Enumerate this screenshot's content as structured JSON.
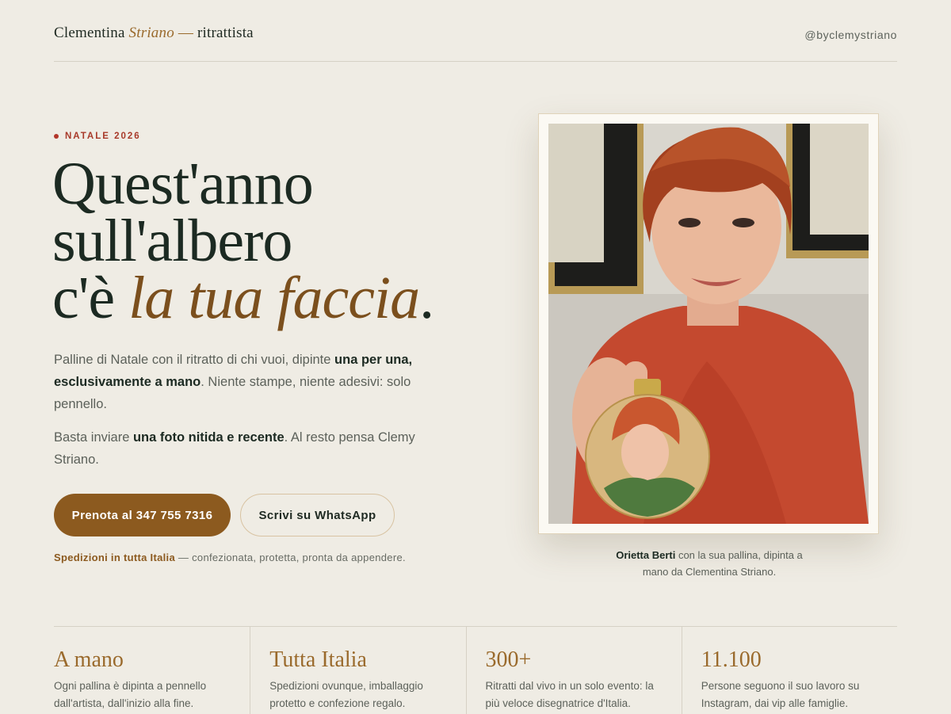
{
  "header": {
    "brand_name": "Clementina",
    "brand_surname": "Striano",
    "brand_dash": "—",
    "brand_role": "ritrattista",
    "handle": "@byclemystriano"
  },
  "hero": {
    "eyebrow": "NATALE 2026",
    "headline_line1": "Quest'anno",
    "headline_line2": "sull'albero",
    "headline_line3_pre": "c'è",
    "headline_line3_italic": "la tua faccia",
    "headline_line3_post": ".",
    "para1_a": "Palline di Natale con il ritratto di chi vuoi, dipinte ",
    "para1_b": "una per una, esclusivamente a mano",
    "para1_c": ". Niente stampe, niente adesivi: solo pennello.",
    "para2_a": "Basta inviare ",
    "para2_b": "una foto nitida e recente",
    "para2_c": ". Al resto pensa Clemy Striano.",
    "cta_primary": "Prenota al 347 755 7316",
    "cta_secondary": "Scrivi su WhatsApp",
    "shipping_highlight": "Spedizioni in tutta Italia",
    "shipping_rest": " — confezionata, protetta, pronta da appendere."
  },
  "photo": {
    "caption_name": "Orietta Berti",
    "caption_rest": " con la sua pallina, dipinta a mano da Clementina Striano."
  },
  "features": [
    {
      "title": "A mano",
      "desc": "Ogni pallina è dipinta a pennello dall'artista, dall'inizio alla fine."
    },
    {
      "title": "Tutta Italia",
      "desc": "Spedizioni ovunque, imballaggio protetto e confezione regalo."
    },
    {
      "title": "300+",
      "desc": "Ritratti dal vivo in un solo evento: la più veloce disegnatrice d'Italia."
    },
    {
      "title": "11.100",
      "desc": "Persone seguono il suo lavoro su Instagram, dai vip alle famiglie."
    }
  ],
  "colors": {
    "background": "#efece4",
    "accent_brown": "#8c5a1f",
    "ink": "#1c2a22",
    "eyebrow_red": "#a83a2a"
  }
}
